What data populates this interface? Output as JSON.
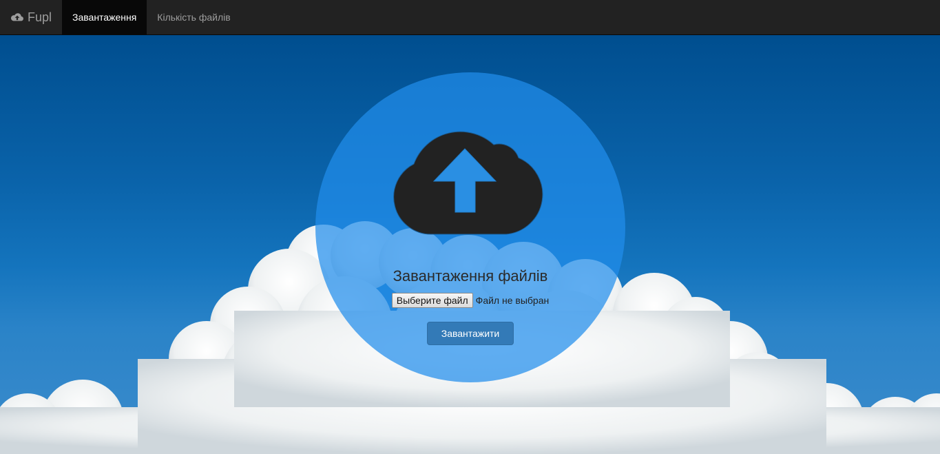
{
  "navbar": {
    "brand_label": "Fupl",
    "items": [
      {
        "label": "Завантаження",
        "active": true
      },
      {
        "label": "Кількість файлів",
        "active": false
      }
    ]
  },
  "upload": {
    "title": "Завантаження файлів",
    "file_button_label": "Выберите файл",
    "file_status": "Файл не выбран",
    "submit_label": "Завантажити"
  },
  "colors": {
    "navbar_bg": "#222222",
    "nav_active_bg": "#080808",
    "circle": "#218eeb",
    "icon": "#222222",
    "submit_button": "#337ab7"
  },
  "icons": {
    "brand": "cloud-upload-icon",
    "main": "cloud-upload-icon"
  }
}
